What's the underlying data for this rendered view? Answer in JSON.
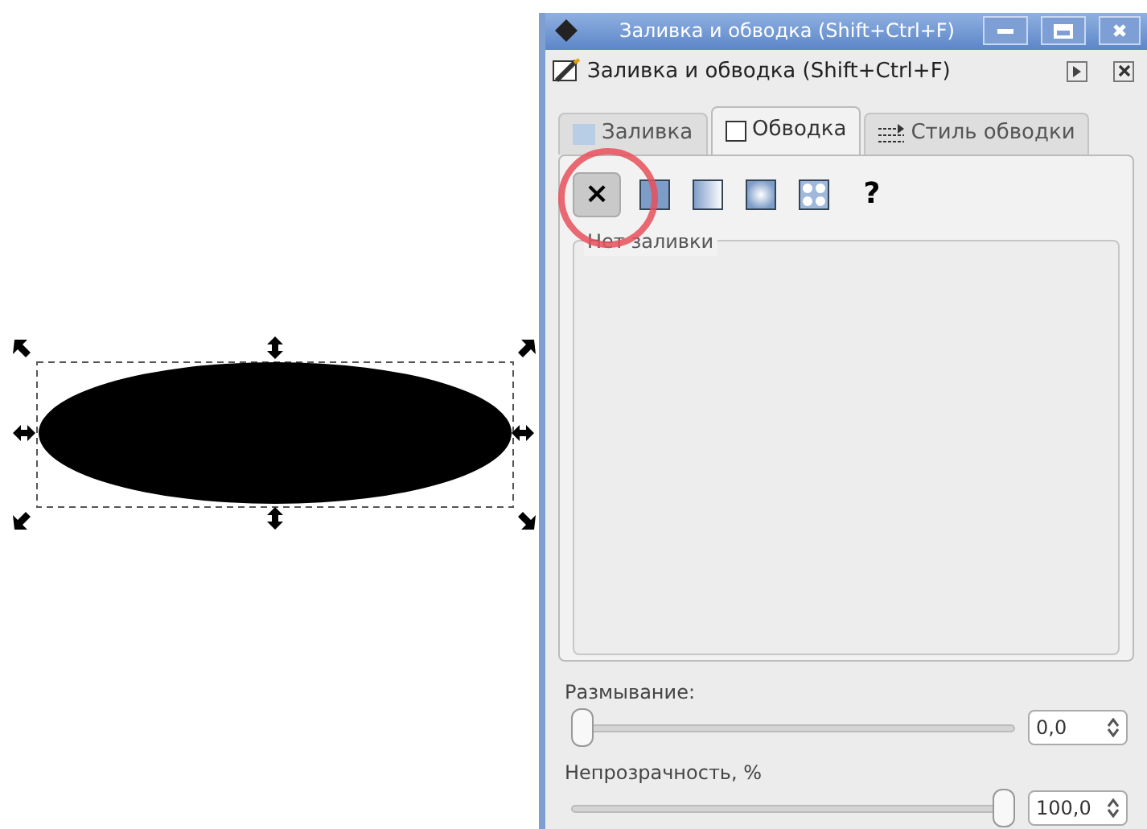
{
  "window": {
    "title": "Заливка и обводка (Shift+Ctrl+F)"
  },
  "dialog": {
    "title": "Заливка и обводка (Shift+Ctrl+F)"
  },
  "tabs": [
    {
      "label": "Заливка",
      "selected": false,
      "kind": "fill"
    },
    {
      "label": "Обводка",
      "selected": true,
      "kind": "stroke"
    },
    {
      "label": "Стиль обводки",
      "selected": false,
      "kind": "style"
    }
  ],
  "paint_modes": [
    {
      "kind": "none",
      "label": "×",
      "selected": true
    },
    {
      "kind": "flat",
      "selected": false
    },
    {
      "kind": "linear",
      "selected": false
    },
    {
      "kind": "radial",
      "selected": false
    },
    {
      "kind": "pattern",
      "selected": false
    },
    {
      "kind": "unset",
      "label": "?",
      "selected": false
    }
  ],
  "group": {
    "title": "Нет заливки"
  },
  "blur": {
    "label": "Размывание:",
    "level": 0,
    "value": "0,0"
  },
  "opacity": {
    "label": "Непрозрачность, %",
    "level": 1,
    "value": "100,0"
  }
}
